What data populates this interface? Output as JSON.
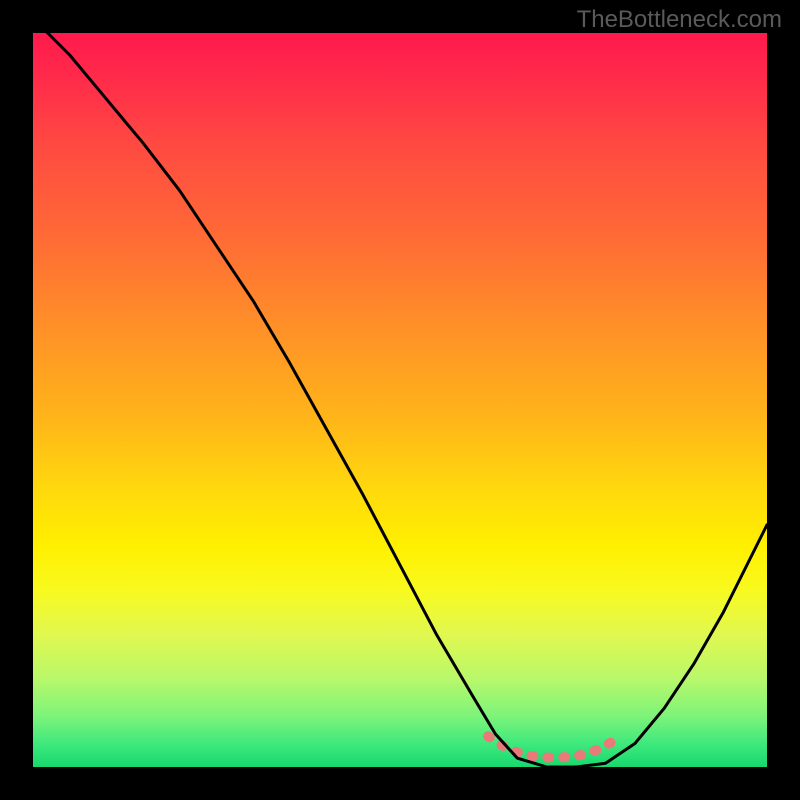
{
  "watermark": "TheBottleneck.com",
  "chart_data": {
    "type": "line",
    "title": "",
    "xlabel": "",
    "ylabel": "",
    "x_range": [
      0,
      100
    ],
    "y_range": [
      0,
      100
    ],
    "series": [
      {
        "name": "bottleneck-curve",
        "x": [
          0,
          5,
          10,
          15,
          20,
          25,
          30,
          35,
          40,
          45,
          50,
          55,
          60,
          63,
          66,
          70,
          74,
          78,
          82,
          86,
          90,
          94,
          100
        ],
        "values": [
          102,
          97,
          91,
          85,
          78.5,
          71,
          63.5,
          55,
          46,
          37,
          27.5,
          18,
          9.5,
          4.5,
          1.2,
          0,
          0,
          0.5,
          3.2,
          8,
          14,
          21,
          33
        ],
        "color": "#000000",
        "width": 3
      },
      {
        "name": "flat-marker",
        "x": [
          62,
          63,
          64,
          65,
          66,
          67,
          68,
          69,
          70,
          71,
          72,
          73,
          74,
          75,
          76,
          77,
          78,
          79,
          80
        ],
        "values": [
          4.2,
          3.5,
          2.9,
          2.4,
          2.0,
          1.7,
          1.5,
          1.4,
          1.3,
          1.3,
          1.3,
          1.4,
          1.5,
          1.7,
          2.0,
          2.4,
          2.9,
          3.5,
          4.2
        ],
        "color": "#e97a7a",
        "width": 10,
        "dashed": true
      }
    ],
    "annotations": []
  },
  "colors": {
    "curve_main": "#000000",
    "curve_marker": "#e97a7a",
    "watermark": "#5a5a5a",
    "frame": "#000000"
  }
}
